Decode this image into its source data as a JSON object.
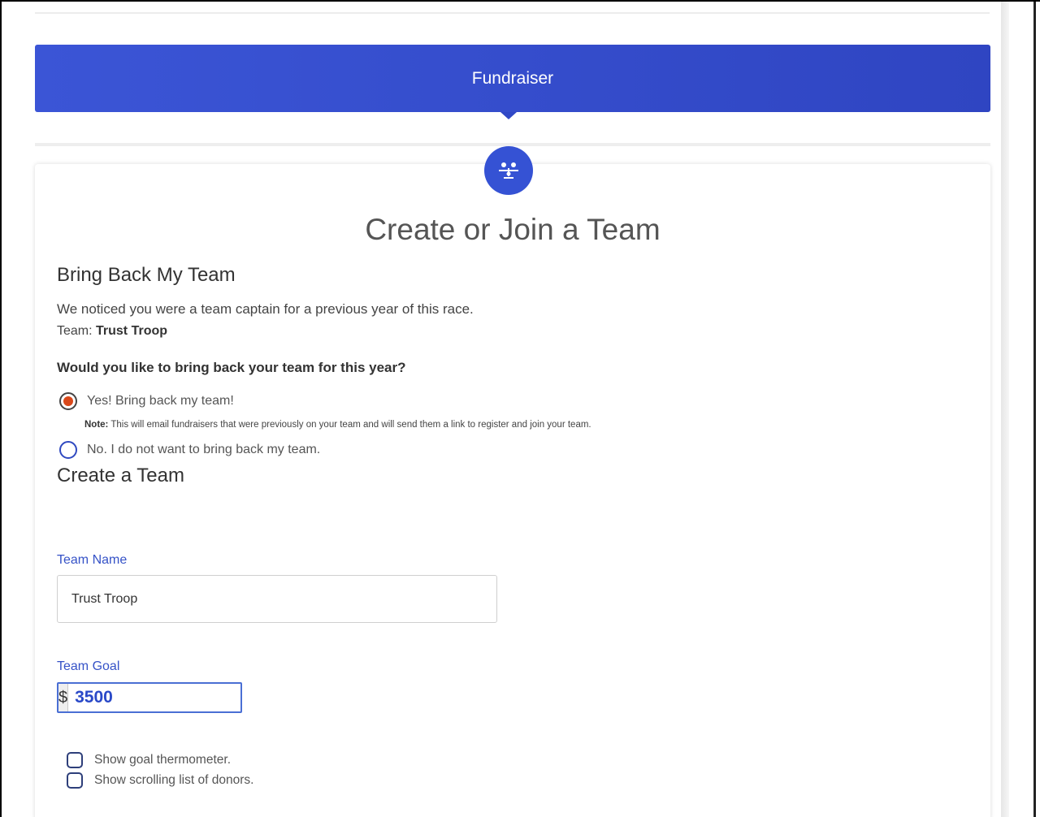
{
  "banner": {
    "title": "Fundraiser"
  },
  "page": {
    "title": "Create or Join a Team"
  },
  "bring_back": {
    "heading": "Bring Back My Team",
    "notice": "We noticed you were a team captain for a previous year of this race.",
    "team_prefix": "Team: ",
    "team_name": "Trust Troop",
    "question": "Would you like to bring back your team for this year?",
    "options": [
      {
        "label": "Yes! Bring back my team!",
        "selected": true
      },
      {
        "label": "No. I do not want to bring back my team.",
        "selected": false
      }
    ],
    "note_label": "Note:",
    "note_text": " This will email fundraisers that were previously on your team and will send them a link to register and join your team."
  },
  "create": {
    "heading": "Create a Team",
    "team_name_label": "Team Name",
    "team_name_value": "Trust Troop",
    "team_goal_label": "Team Goal",
    "currency": "$",
    "team_goal_value": "3500",
    "checkboxes": [
      {
        "label": "Show goal thermometer.",
        "checked": false
      },
      {
        "label": "Show scrolling list of donors.",
        "checked": false
      }
    ]
  },
  "colors": {
    "brand_blue": "#3552d4",
    "radio_selected": "#d9481a",
    "label_blue": "#3552c7"
  },
  "icons": {
    "team": "team-icon",
    "spinner": "number-spinner-icon"
  }
}
